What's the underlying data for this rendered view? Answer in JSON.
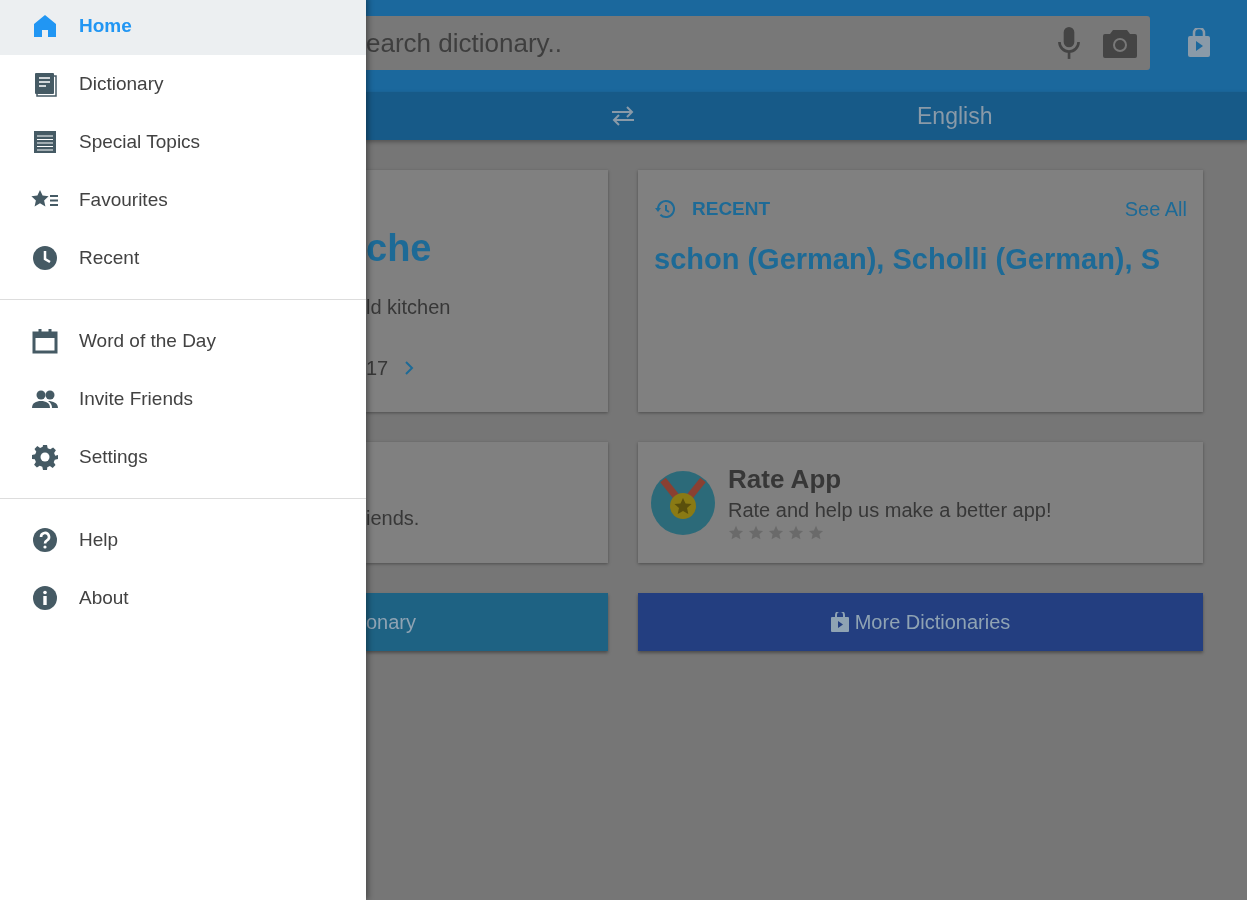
{
  "drawer": {
    "groups": [
      {
        "items": [
          {
            "label": "Home",
            "selected": true
          },
          {
            "label": "Dictionary",
            "selected": false
          },
          {
            "label": "Special Topics",
            "selected": false
          },
          {
            "label": "Favourites",
            "selected": false
          },
          {
            "label": "Recent",
            "selected": false
          }
        ]
      },
      {
        "items": [
          {
            "label": "Word of the Day",
            "selected": false
          },
          {
            "label": "Invite Friends",
            "selected": false
          },
          {
            "label": "Settings",
            "selected": false
          }
        ]
      },
      {
        "items": [
          {
            "label": "Help",
            "selected": false
          },
          {
            "label": "About",
            "selected": false
          }
        ]
      }
    ]
  },
  "search": {
    "placeholder": "earch dictionary.."
  },
  "language_bar": {
    "target": "English"
  },
  "word_card": {
    "title": "che",
    "meaning": "ld kitchen",
    "date": "17"
  },
  "recent_card": {
    "heading": "RECENT",
    "see_all": "See All",
    "words": "schon (German), Scholli (German), S"
  },
  "invite_card": {
    "text": "iends."
  },
  "rate_card": {
    "title": "Rate App",
    "text": "Rate and help us make a better app!",
    "stars": 0
  },
  "buttons": [
    {
      "label": "onary",
      "kind": "dictionary"
    },
    {
      "label": "More Dictionaries",
      "kind": "store"
    }
  ]
}
